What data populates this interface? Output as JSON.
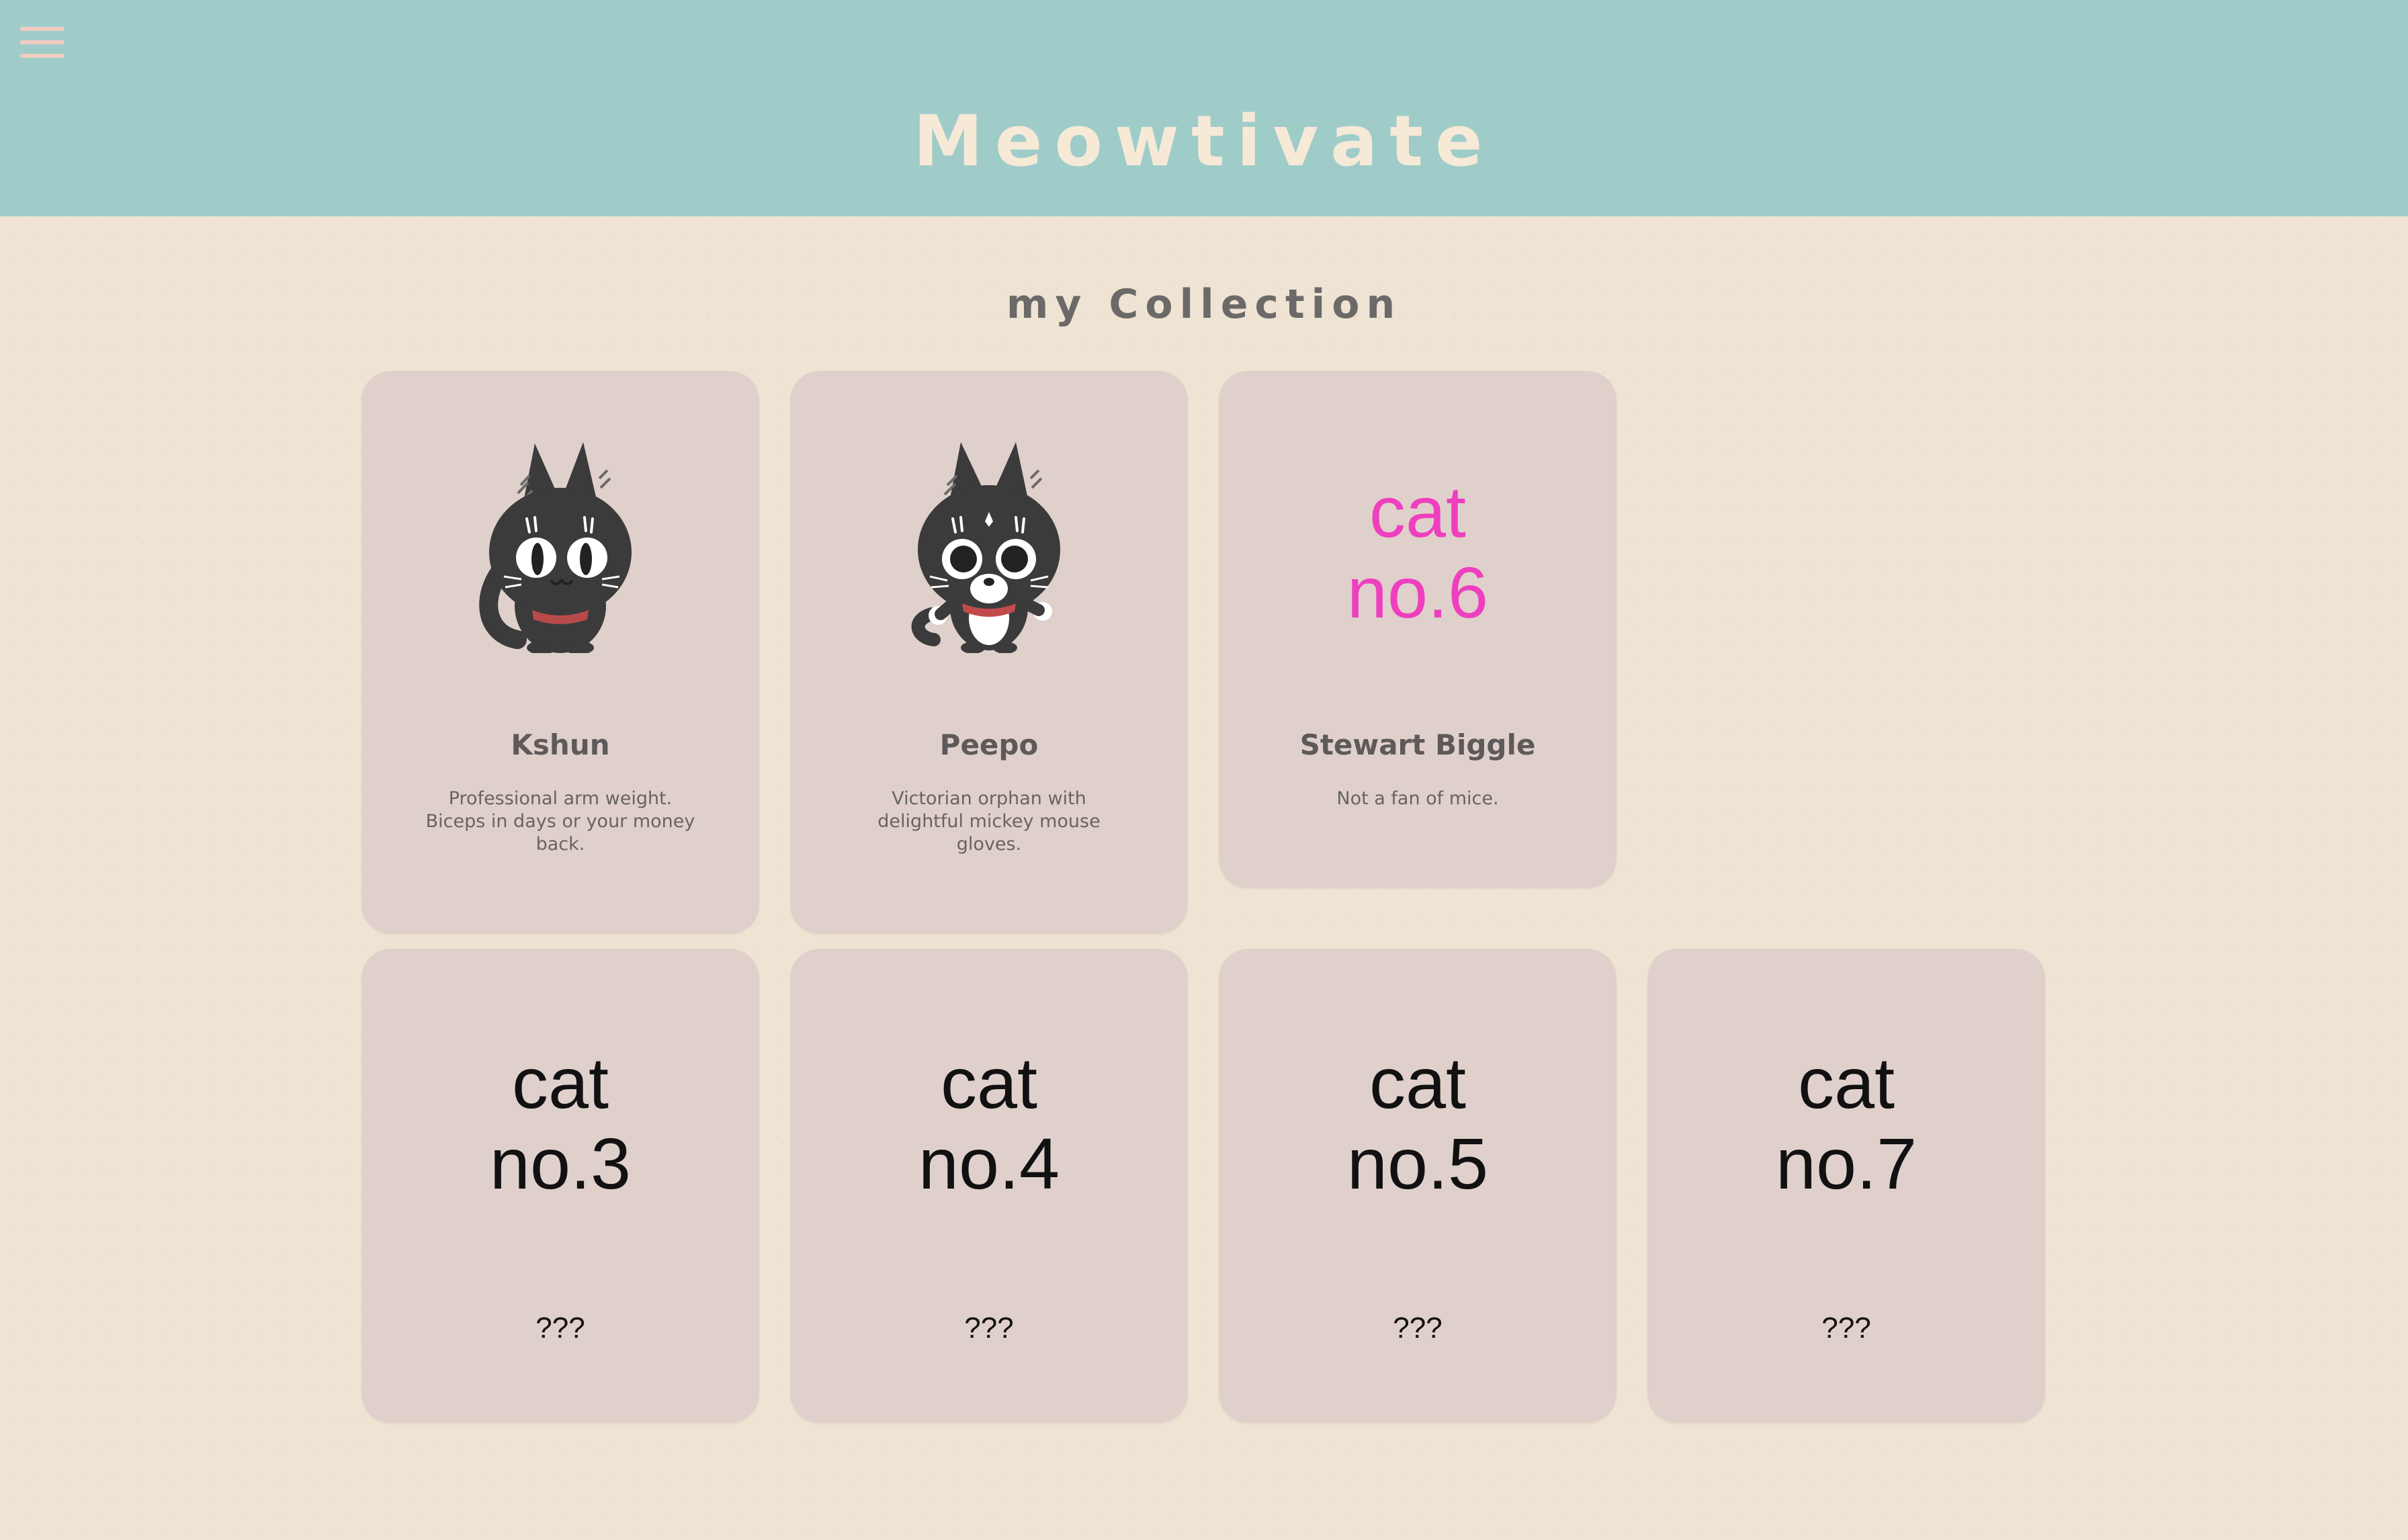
{
  "header": {
    "title": "Meowtivate",
    "menu_icon": "hamburger-menu-icon",
    "background_color": "#9fccc9",
    "title_color": "#f6ead7"
  },
  "collection": {
    "title": "my Collection",
    "cards": [
      {
        "label": "Kshun",
        "description": "Professional arm weight. Biceps in days or your money back.",
        "art": "black-cat-kshun-icon",
        "unlocked": true
      },
      {
        "label": "Peepo",
        "description": "Victorian orphan with delightful mickey mouse gloves.",
        "art": "tuxedo-cat-peepo-icon",
        "unlocked": true
      },
      {
        "label": "Stewart Biggle",
        "description": "Not a fan of mice.",
        "placeholder_line1": "cat",
        "placeholder_line2": "no.6",
        "placeholder_color": "#ee3fbf",
        "unlocked": true
      },
      {
        "label": "???",
        "placeholder_line1": "cat",
        "placeholder_line2": "no.3",
        "unlocked": false
      },
      {
        "label": "???",
        "placeholder_line1": "cat",
        "placeholder_line2": "no.4",
        "unlocked": false
      },
      {
        "label": "???",
        "placeholder_line1": "cat",
        "placeholder_line2": "no.5",
        "unlocked": false
      },
      {
        "label": "???",
        "placeholder_line1": "cat",
        "placeholder_line2": "no.7",
        "unlocked": false
      }
    ]
  },
  "colors": {
    "page_background": "#efe3d3",
    "card_background": "#e0d0cb",
    "menu_icon_color": "#f2ccc0"
  }
}
